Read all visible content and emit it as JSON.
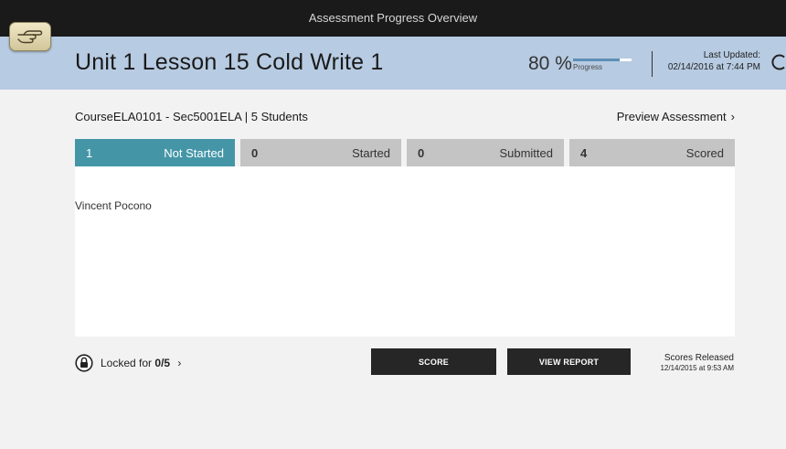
{
  "topbar": {
    "title": "Assessment Progress Overview"
  },
  "header": {
    "title": "Unit 1 Lesson 15 Cold Write 1",
    "percent": "80 %",
    "progress_value": 0.8,
    "progress_label": "Progress",
    "last_updated_label": "Last Updated:",
    "last_updated_value": "02/14/2016 at 7:44 PM"
  },
  "course": {
    "prefix": "CourseELA0101 - Sec5001ELA |",
    "count": "5",
    "suffix": "Students"
  },
  "preview_label": "Preview Assessment",
  "chevron": "›",
  "tabs": [
    {
      "count": "1",
      "label": "Not Started",
      "active": true
    },
    {
      "count": "0",
      "label": "Started"
    },
    {
      "count": "0",
      "label": "Submitted"
    },
    {
      "count": "4",
      "label": "Scored"
    }
  ],
  "students": [
    "Vincent Pocono"
  ],
  "footer": {
    "locked_prefix": "Locked for",
    "locked_value": "0/5",
    "score_button": "SCORE",
    "view_report_button": "VIEW REPORT",
    "scores_released_label": "Scores Released",
    "scores_released_date": "12/14/2015 at 9:53 AM"
  },
  "icons": {
    "hand": "pointing-hand-icon",
    "refresh": "refresh-icon",
    "lock": "lock-icon",
    "chevron": "chevron-right-icon"
  },
  "colors": {
    "header_bg": "#b7cbe2",
    "active_tab": "#4496a7",
    "inactive_tab": "#c4c4c4",
    "button": "#262626",
    "topbar": "#1a1a1a"
  }
}
